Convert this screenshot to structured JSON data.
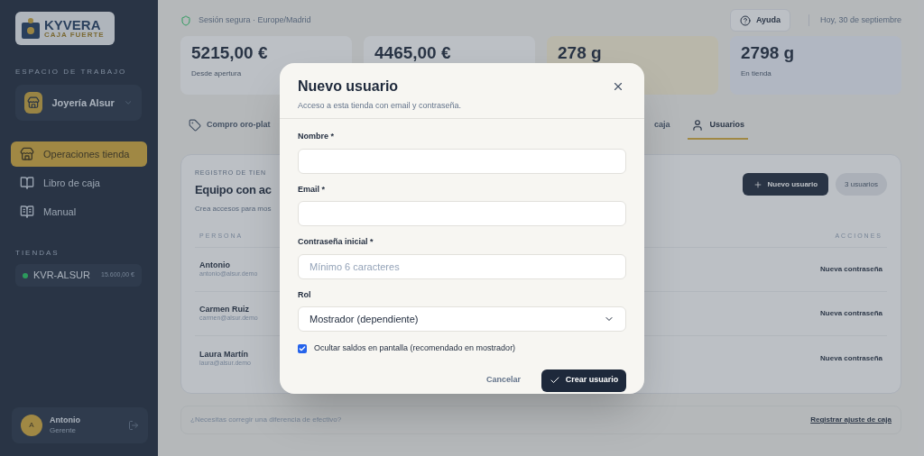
{
  "sidebar": {
    "logo": {
      "name": "KYVERA",
      "tagline": "CAJA FUERTE"
    },
    "workspace_label": "ESPACIO DE TRABAJO",
    "workspace": "Joyería Alsur",
    "nav": [
      {
        "label": "Operaciones tienda",
        "selected": true
      },
      {
        "label": "Libro de caja",
        "selected": false
      },
      {
        "label": "Manual",
        "selected": false
      }
    ],
    "stores_label": "TIENDAS",
    "stores": [
      {
        "code": "KVR-ALSUR",
        "amount": "15.600,00 €"
      }
    ],
    "user": {
      "initial": "A",
      "name": "Antonio",
      "role": "Gerente"
    }
  },
  "topbar": {
    "session": "Sesión segura · Europe/Madrid",
    "help": "Ayuda",
    "date": "Hoy, 30 de septiembre"
  },
  "stats": [
    {
      "value": "5215,00 €",
      "caption": "Desde apertura",
      "kind": "plain"
    },
    {
      "value": "4465,00 €",
      "kind": "plain"
    },
    {
      "value": "278 g",
      "kind": "highlight"
    },
    {
      "value": "2798 g",
      "caption": "En tienda",
      "kind": "info"
    }
  ],
  "tabs": [
    {
      "label": "Compro oro-plat",
      "selected": false
    },
    {
      "label": "caja",
      "selected": false
    },
    {
      "label": "Usuarios",
      "selected": true
    }
  ],
  "panel": {
    "eyebrow": "REGISTRO DE TIEN",
    "title": "Equipo con ac",
    "description": "Crea accesos para mos",
    "new_button": "Nuevo usuario",
    "count": "3 usuarios",
    "columns": [
      "PERSONA",
      "ACCIONES"
    ],
    "rows": [
      {
        "name": "Antonio",
        "email": "antonio@alsur.demo",
        "action": "Nueva contraseña"
      },
      {
        "name": "Carmen Ruiz",
        "email": "carmen@alsur.demo",
        "action": "Nueva contraseña"
      },
      {
        "name": "Laura Martín",
        "email": "laura@alsur.demo",
        "action": "Nueva contraseña"
      }
    ]
  },
  "footer": {
    "question": "¿Necesitas corregir una diferencia de efectivo?",
    "link": "Registrar ajuste de caja"
  },
  "dialog": {
    "title": "Nuevo usuario",
    "subtitle": "Acceso a esta tienda con email y contraseña.",
    "fields": [
      {
        "kind": "text",
        "label": "Nombre *"
      },
      {
        "kind": "text",
        "label": "Email *"
      },
      {
        "kind": "password",
        "label": "Contraseña inicial *",
        "placeholder": "Mínimo 6 caracteres"
      },
      {
        "kind": "select",
        "label": "Rol",
        "value": "Mostrador (dependiente)"
      }
    ],
    "checkbox": {
      "label": "Ocultar saldos en pantalla (recomendado en mostrador)",
      "checked": true
    },
    "cancel": "Cancelar",
    "submit": "Crear usuario"
  }
}
